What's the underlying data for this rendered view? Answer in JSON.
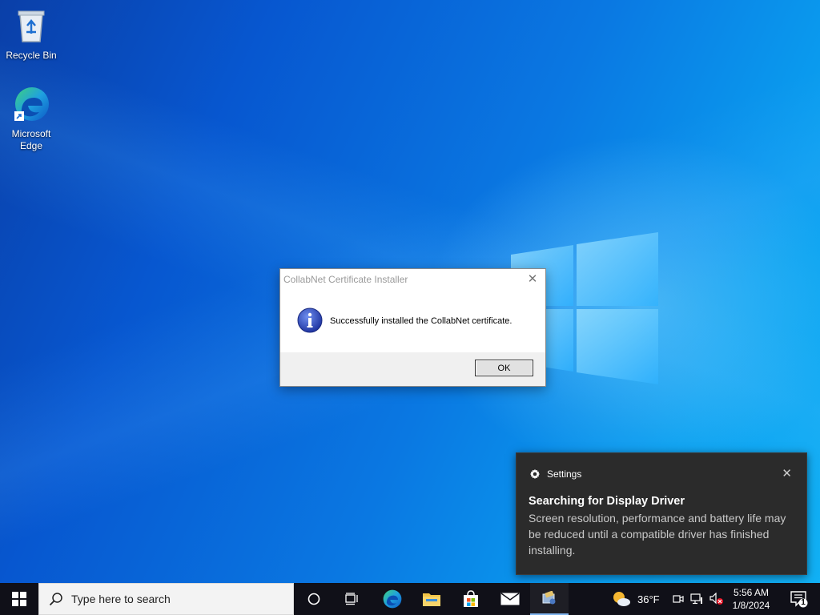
{
  "desktop": {
    "icons": [
      {
        "label": "Recycle Bin"
      },
      {
        "label": "Microsoft Edge"
      }
    ]
  },
  "dialog": {
    "title": "CollabNet Certificate Installer",
    "message": "Successfully installed the CollabNet certificate.",
    "ok_label": "OK",
    "close_glyph": "✕"
  },
  "toast": {
    "app": "Settings",
    "title": "Searching for Display Driver",
    "body": "Screen resolution, performance and battery life may be reduced until a compatible driver has finished installing.",
    "close_glyph": "✕"
  },
  "taskbar": {
    "search_placeholder": "Type here to search",
    "weather_temp": "36°F",
    "time": "5:56 AM",
    "date": "1/8/2024",
    "notification_count": "1"
  },
  "colors": {
    "accent": "#0078d7",
    "taskbar": "#101018",
    "toast_bg": "#2b2b2b"
  }
}
